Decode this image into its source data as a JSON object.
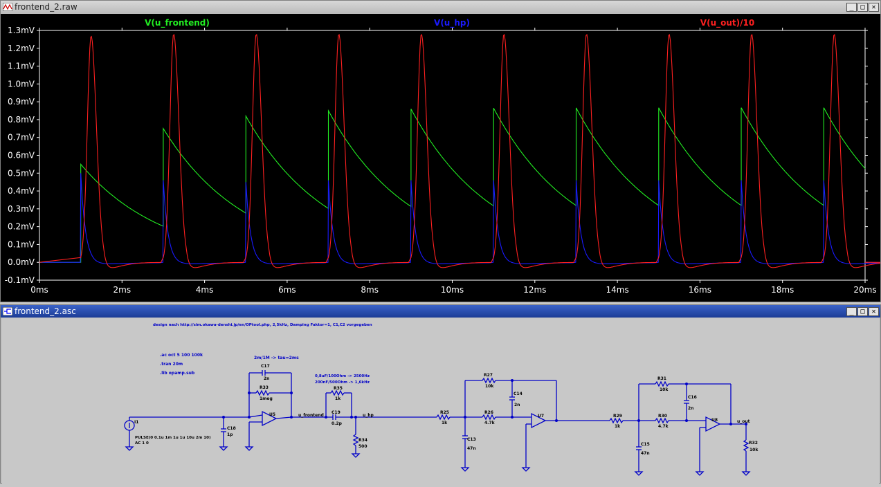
{
  "waveform_window": {
    "title": "frontend_2.raw",
    "buttons": {
      "minimize": "_",
      "maximize": "□",
      "close": "✕"
    }
  },
  "schematic_window": {
    "title": "frontend_2.asc",
    "buttons": {
      "minimize": "_",
      "maximize": "□",
      "close": "✕"
    }
  },
  "colors": {
    "green": "#22ee22",
    "blue": "#1a1aff",
    "red": "#ff2020",
    "wire": "#0000c8",
    "plot_bg": "#000000"
  },
  "chart_data": {
    "type": "line",
    "xlabel": "",
    "ylabel": "",
    "xlim": [
      0,
      20
    ],
    "ylim": [
      -0.1,
      1.3
    ],
    "x_unit": "ms",
    "y_unit": "mV",
    "x_ticks": [
      "0ms",
      "2ms",
      "4ms",
      "6ms",
      "8ms",
      "10ms",
      "12ms",
      "14ms",
      "16ms",
      "18ms",
      "20ms"
    ],
    "y_ticks": [
      "-0.1mV",
      "0.0mV",
      "0.1mV",
      "0.2mV",
      "0.3mV",
      "0.4mV",
      "0.5mV",
      "0.6mV",
      "0.7mV",
      "0.8mV",
      "0.9mV",
      "1.0mV",
      "1.1mV",
      "1.2mV",
      "1.3mV"
    ],
    "grid": false,
    "legend_position": "top",
    "pulse_times_ms": [
      1,
      3,
      5,
      7,
      9,
      11,
      13,
      15,
      17,
      19
    ],
    "series": [
      {
        "name": "V(u_frontend)",
        "color": "#22ee22",
        "description_points": {
          "peaks_mV": [
            0.55,
            0.75,
            0.82,
            0.85,
            0.86,
            0.865,
            0.866,
            0.867,
            0.867,
            0.867
          ],
          "troughs_mV": [
            0.0,
            0.2,
            0.28,
            0.3,
            0.32,
            0.32,
            0.32,
            0.32,
            0.32,
            0.32
          ]
        },
        "tau_ms": 2.0
      },
      {
        "name": "V(u_hp)",
        "color": "#1a1aff",
        "peaks_mV": [
          0.5,
          0.46,
          0.45,
          0.46,
          0.46,
          0.46,
          0.46,
          0.46,
          0.46,
          0.46
        ],
        "undershoot_mV": -0.02
      },
      {
        "name": "V(u_out)/10",
        "color": "#ff2020",
        "peaks_mV": [
          1.27,
          1.28,
          1.28,
          1.28,
          1.28,
          1.28,
          1.28,
          1.28,
          1.28,
          1.28
        ],
        "undershoot_mV": -0.03,
        "delay_ms": 0.25
      }
    ]
  },
  "schematic": {
    "header_note": "design nach http://sim.okawa-denshi.jp/en/OPtool.php, 2,5kHz, Damping Faktor=1, C1,C2 vorgegeben",
    "directives": [
      ".ac oct 5 100 100k",
      ".tran 20m",
      ".lib opamp.sub"
    ],
    "notes": {
      "tau": "2m/1M -> tau=2ms",
      "hp1": "0,8uF/100Ohm -> 2500Hz",
      "hp2": "200nF/500Ohm -> 1,6kHz"
    },
    "components": {
      "I1": "I1",
      "I1_val1": "PULSE(0 0.1u 1m 1u 1u 10u 2m 10)",
      "I1_val2": "AC 1 0",
      "C18": "C18",
      "C18_val": "1p",
      "C17": "C17",
      "C17_val": "2n",
      "R33": "R33",
      "R33_val": "1meg",
      "U5": "U5",
      "R35": "R35",
      "R35_val": "1k",
      "C19": "C19",
      "C19_val": "0.2p",
      "R34": "R34",
      "R34_val": "500",
      "R27": "R27",
      "R27_val": "10k",
      "C14": "C14",
      "C14_val": "2n",
      "R25": "R25",
      "R25_val": "1k",
      "R26": "R26",
      "R26_val": "4.7k",
      "C13": "C13",
      "C13_val": "47n",
      "U7": "U7",
      "R31": "R31",
      "R31_val": "10k",
      "C16": "C16",
      "C16_val": "2n",
      "R29": "R29",
      "R29_val": "1k",
      "R30": "R30",
      "R30_val": "4.7k",
      "C15": "C15",
      "C15_val": "47n",
      "U8": "U8",
      "R32": "R32",
      "R32_val": "10k"
    },
    "net_labels": {
      "u_frontend": "u_frontend",
      "u_hp": "u_hp",
      "u_out": "u_out"
    }
  }
}
